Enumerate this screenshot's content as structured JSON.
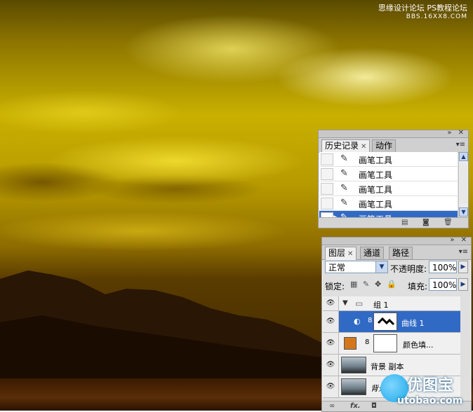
{
  "watermark": {
    "line1": "思缘设计论坛  PS教程论坛",
    "line2": "BBS.16XX8.COM"
  },
  "history_panel": {
    "tabs": [
      {
        "label": "历史记录",
        "active": true
      },
      {
        "label": "动作",
        "active": false
      }
    ],
    "items": [
      {
        "label": "画笔工具",
        "selected": false
      },
      {
        "label": "画笔工具",
        "selected": false
      },
      {
        "label": "画笔工具",
        "selected": false
      },
      {
        "label": "画笔工具",
        "selected": false
      },
      {
        "label": "画笔工具",
        "selected": true
      }
    ]
  },
  "layers_panel": {
    "tabs": [
      {
        "label": "图层",
        "active": true
      },
      {
        "label": "通道",
        "active": false
      },
      {
        "label": "路径",
        "active": false
      }
    ],
    "blend_mode": "正常",
    "opacity_label": "不透明度:",
    "opacity_value": "100%",
    "lock_label": "锁定:",
    "fill_label": "填充:",
    "fill_value": "100%",
    "layers": [
      {
        "name": "组 1",
        "type": "group",
        "selected": false
      },
      {
        "name": "曲线 1",
        "type": "adjustment",
        "selected": true
      },
      {
        "name": "颜色填...",
        "type": "fill",
        "selected": false,
        "fill_color": "#d4761c"
      },
      {
        "name": "背景 副本",
        "type": "image",
        "selected": false
      },
      {
        "name": "背景",
        "type": "image",
        "selected": false
      }
    ]
  },
  "logo": {
    "name": "优图宝",
    "url": "utobao.com"
  }
}
